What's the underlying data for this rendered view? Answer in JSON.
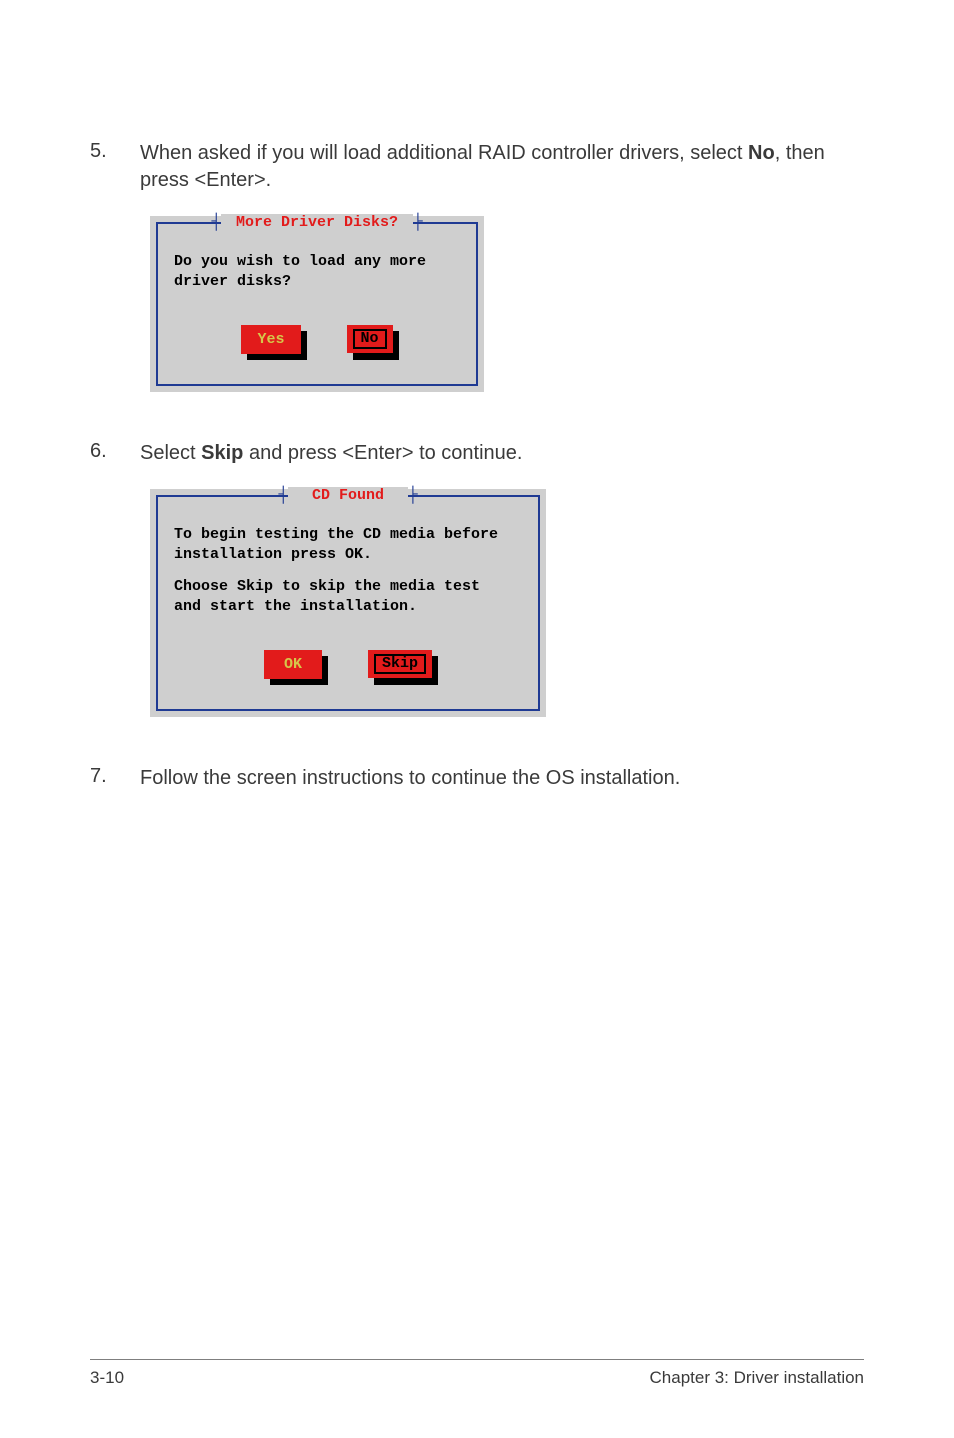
{
  "steps": {
    "s5": {
      "num": "5.",
      "text_pre": "When asked if you will load additional RAID controller drivers, select ",
      "bold": "No",
      "text_post": ", then press <Enter>."
    },
    "s6": {
      "num": "6.",
      "text_pre": "Select ",
      "bold": "Skip",
      "text_post": " and press <Enter> to continue."
    },
    "s7": {
      "num": "7.",
      "text": "Follow the screen instructions to continue the OS installation."
    }
  },
  "dialog1": {
    "title_ticks_left": "┤",
    "title": " More Driver Disks? ",
    "title_ticks_right": "├",
    "body": "Do you wish to load any more\ndriver disks?",
    "btn_yes": "Yes",
    "btn_no": "No"
  },
  "dialog2": {
    "title_ticks_left": "┤",
    "title": "  CD Found  ",
    "title_ticks_right": "├",
    "para1": "To begin testing the CD media before\ninstallation press OK.",
    "para2": "Choose Skip to skip the media test\nand start the installation.",
    "btn_ok": "OK",
    "btn_skip": "Skip"
  },
  "footer": {
    "page": "3-10",
    "chapter": "Chapter 3: Driver installation"
  }
}
